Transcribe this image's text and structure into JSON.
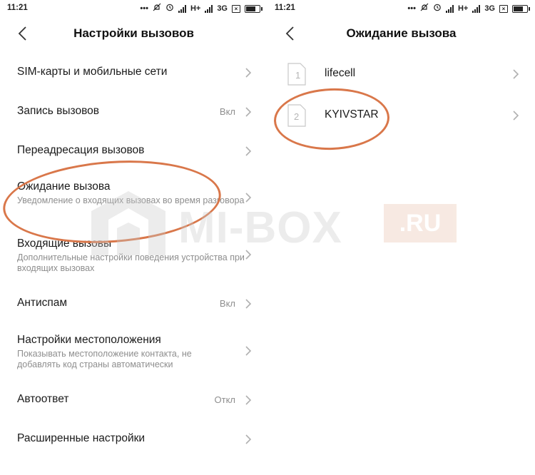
{
  "left": {
    "status": {
      "time": "11:21",
      "network": "H+",
      "network2": "3G"
    },
    "header": {
      "title": "Настройки вызовов"
    },
    "items": [
      {
        "label": "SIM-карты и мобильные сети",
        "value": "",
        "sub": ""
      },
      {
        "label": "Запись вызовов",
        "value": "Вкл",
        "sub": ""
      },
      {
        "label": "Переадресация вызовов",
        "value": "",
        "sub": ""
      },
      {
        "label": "Ожидание вызова",
        "value": "",
        "sub": "Уведомление о входящих вызовах во время разговора"
      },
      {
        "label": "Входящие вызовы",
        "value": "",
        "sub": "Дополнительные настройки поведения устройства при входящих вызовах"
      },
      {
        "label": "Антиспам",
        "value": "Вкл",
        "sub": ""
      },
      {
        "label": "Настройки местоположения",
        "value": "",
        "sub": "Показывать местоположение контакта, не добавлять код страны автоматически"
      },
      {
        "label": "Автоответ",
        "value": "Откл",
        "sub": ""
      },
      {
        "label": "Расширенные настройки",
        "value": "",
        "sub": ""
      }
    ]
  },
  "right": {
    "status": {
      "time": "11:21",
      "network": "H+",
      "network2": "3G"
    },
    "header": {
      "title": "Ожидание вызова"
    },
    "sims": [
      {
        "slot": "1",
        "name": "lifecell"
      },
      {
        "slot": "2",
        "name": "KYIVSTAR"
      }
    ]
  },
  "watermark": {
    "text": "MI-BOX",
    "suffix": ".RU"
  },
  "icons": {
    "back": "chevron-left-icon",
    "row": "chevron-right-icon",
    "sim": "sim-card-icon",
    "status": [
      "more-dots-icon",
      "mute-icon",
      "alarm-icon",
      "signal-icon",
      "no-sim-icon",
      "battery-icon"
    ]
  },
  "colors": {
    "highlight": "#d9774a",
    "text": "#1a1a1a",
    "secondary": "#8e8e8e",
    "chevron": "#b0b0b0"
  }
}
